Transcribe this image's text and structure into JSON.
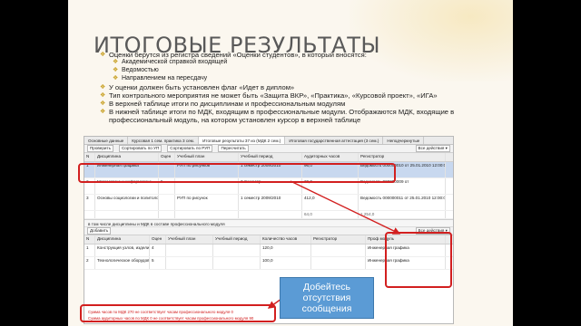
{
  "slide": {
    "title": "ИТОГОВЫЕ РЕЗУЛЬТАТЫ",
    "bullets": [
      {
        "level": 0,
        "text": "Оценки берутся из регистра сведений «Оценки студентов», в который вносятся:"
      },
      {
        "level": 1,
        "text": "Академической справкой входящей"
      },
      {
        "level": 1,
        "text": "Ведомостью"
      },
      {
        "level": 1,
        "text": "Направлением на пересдачу"
      },
      {
        "level": 0,
        "text": "У оценки должен быть установлен флаг «Идет в диплом»"
      },
      {
        "level": 0,
        "text": "Тип контрольного мероприятия не может быть «Защита ВКР», «Практика», «Курсовой проект», «ИГА»"
      },
      {
        "level": 0,
        "text": "В верхней таблице итоги по дисциплинам и профессиональным модулям"
      },
      {
        "level": 0,
        "text": "В нижней таблице итоги по МДК, входящим в профессиональные модули. Отображаются МДК, входящие в профессиональный модуль, на котором установлен курсор в верхней таблице"
      }
    ],
    "bullet_marker": "❖",
    "callout": {
      "line1": "Добейтесь",
      "line2": "отсутствия",
      "line3": "сообщения"
    },
    "accent_color": "#d21f1f",
    "callout_color": "#5b9bd5"
  },
  "app": {
    "tabs": [
      {
        "label": "Основные данные",
        "active": false
      },
      {
        "label": "Курсовая 1 сем. практика 3 сем.",
        "active": false
      },
      {
        "label": "Итоговые результаты 37 из (МДК 2 сем.)",
        "active": true
      },
      {
        "label": "Итоговая государственная аттестация (3 сем.)",
        "active": false
      },
      {
        "label": "Неподчеркнутые",
        "active": false
      }
    ],
    "toolbar": {
      "check": "Проверить",
      "sort": "Сортировать по УП",
      "sort_rup": "Сортировать по РУП",
      "recalc": "Пересчитать",
      "more": "Все действия ▾"
    },
    "upper_table": {
      "headers": [
        "N",
        "Дисциплина",
        "Оцен",
        "Учебный план",
        "Учебный период",
        "Аудиторных часов",
        "Регистратор"
      ],
      "subheaders": [
        "",
        "",
        "Зачет",
        "Строка РУП",
        "Семестр",
        "Аудиторных часов",
        ""
      ],
      "rows": [
        {
          "n": "1",
          "disc": "Инженерная графика",
          "mark": "",
          "plan": "РУП по рисунков",
          "plan2": "Инженерная графика",
          "period": "1 семестр 2009/2010",
          "period2": "3 Семестр",
          "hours": "96,0",
          "reg": "Ведомость 000000010 от 25.01.2010 12:00:00",
          "selected": true
        },
        {
          "n": "2",
          "disc": "Математика и информатика",
          "mark": "5",
          "plan": "",
          "plan2": "Математика и информатика",
          "period": "3 Семестр",
          "period2": "",
          "hours": "30,0",
          "reg": "Ведомость 000000009 от",
          "selected": false
        },
        {
          "n": "3",
          "disc": "Основы социологии и политологии",
          "mark": "",
          "plan": "РУП по рисунок",
          "plan2": "Основы социологии и политологии",
          "period": "1 семестр 2009/2010",
          "period2": "3 Семестр",
          "hours": "412,0",
          "reg": "Ведомость 000000011 от 25.01.2010 12:00:00",
          "selected": false
        }
      ],
      "totals": [
        "",
        "",
        "",
        "",
        "",
        "64,0",
        "1 254,0"
      ]
    },
    "lower_label": "в том числе дисциплины и МДК в составе профессионального модуля",
    "lower_toolbar": {
      "add": "Добавить",
      "more": "Все действия ▾"
    },
    "lower_table": {
      "headers": [
        "N",
        "Дисциплина",
        "Оцен",
        "Учебный план",
        "Учебный период",
        "Количество часов",
        "Регистратор",
        "Проф модуль"
      ],
      "subheaders": [
        "",
        "",
        "Зачет",
        "Строка РУП",
        "Семестр",
        "Аудиторных часов",
        "",
        ""
      ],
      "rows": [
        {
          "n": "1",
          "disc": "Конструкция узлов, изделий и систем",
          "mark": "4",
          "plan": "",
          "period": "",
          "hours": "120,0",
          "reg": "",
          "module": "Инженерная графика"
        },
        {
          "n": "2",
          "disc": "Технологическое оборудование для ...",
          "mark": "5",
          "plan": "",
          "period": "",
          "hours": "100,0",
          "reg": "",
          "module": "Инженерная графика"
        }
      ]
    },
    "status": [
      "Сумма часов по МДК 270 не соответствует часам профессионального модуля 0",
      "Сумма аудиторных часов по МДК 0 не соответствует часам профессионального модуля 90"
    ]
  }
}
